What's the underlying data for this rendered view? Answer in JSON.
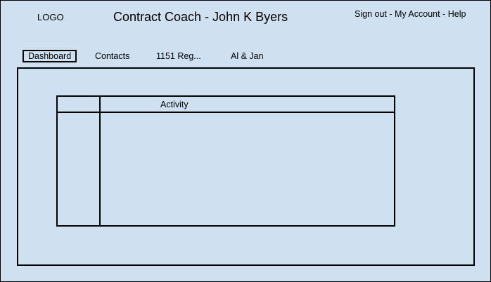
{
  "header": {
    "logo": "LOGO",
    "title": "Contract Coach - John K Byers",
    "links": {
      "sign_out": "Sign out",
      "separator": " - ",
      "my_account": "My Account",
      "help": "Help"
    }
  },
  "tabs": [
    {
      "label": "Dashboard",
      "active": true
    },
    {
      "label": "Contacts",
      "active": false
    },
    {
      "label": "1151 Reg...",
      "active": false
    },
    {
      "label": "Al & Jan",
      "active": false
    }
  ],
  "table": {
    "columns": [
      "",
      "Activity"
    ]
  },
  "colors": {
    "background": "#cfe0f1",
    "border": "#000000"
  }
}
